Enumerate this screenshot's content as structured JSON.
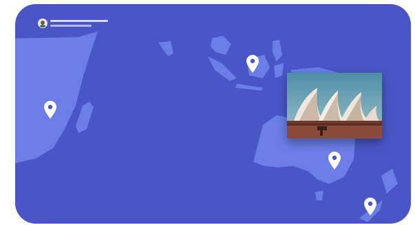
{
  "header": {
    "avatar_icon": "user-avatar-icon"
  },
  "pins": [
    {
      "name": "pin-africa-east",
      "icon": "location-pin-icon"
    },
    {
      "name": "pin-southeast-asia",
      "icon": "location-pin-icon"
    },
    {
      "name": "pin-australia-east",
      "icon": "location-pin-icon"
    },
    {
      "name": "pin-new-zealand",
      "icon": "location-pin-icon"
    }
  ],
  "photo": {
    "subject": "sydney-opera-house-photo",
    "icon": "photo-thumbnail"
  },
  "colors": {
    "ocean": "#4a56c6",
    "land": "#6a7ee6",
    "pin": "#ffffff",
    "header_line": "#d6dbff"
  }
}
